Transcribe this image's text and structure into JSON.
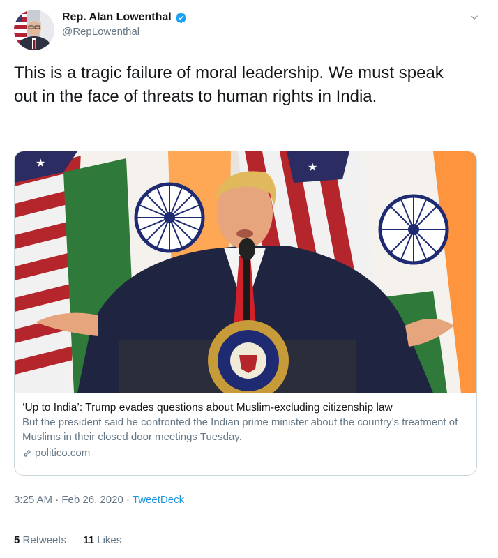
{
  "user": {
    "display_name": "Rep. Alan Lowenthal",
    "handle": "@RepLowenthal",
    "verified": true
  },
  "tweet": {
    "text": "This is a tragic failure of moral leadership. We must speak out in the face of threats to human rights in India."
  },
  "card": {
    "title": "‘Up to India’: Trump evades questions about Muslim-excluding citizenship law",
    "description": "But the president said he confronted the Indian prime minister about the country’s treatment of Muslims in their closed door meetings Tuesday.",
    "domain": "politico.com"
  },
  "meta": {
    "time": "3:25 AM",
    "date": "Feb 26, 2020",
    "separator": "·",
    "source": "TweetDeck"
  },
  "stats": {
    "retweets_count": "5",
    "retweets_label": "Retweets",
    "likes_count": "11",
    "likes_label": "Likes"
  },
  "colors": {
    "link": "#1b95e0",
    "verified": "#1da1f2",
    "secondary_text": "#657786"
  }
}
